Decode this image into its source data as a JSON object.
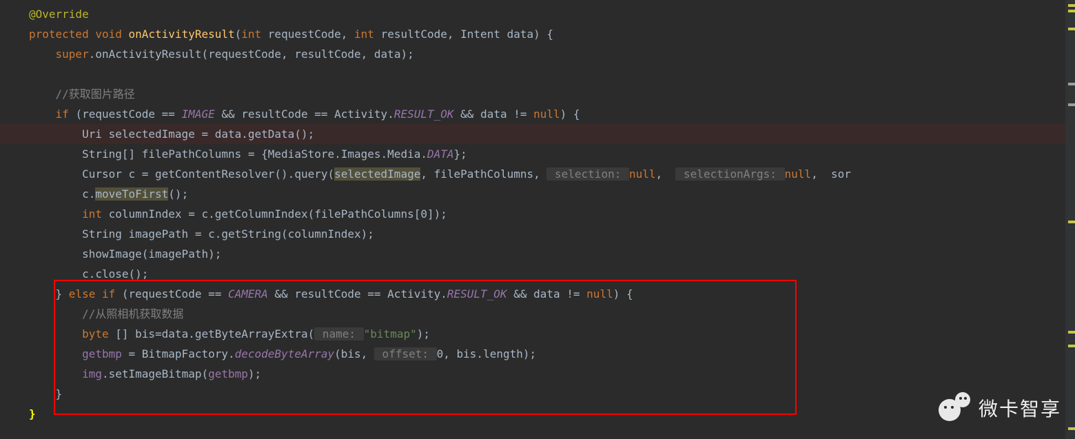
{
  "code": {
    "l1": "@Override",
    "l2_protected": "protected ",
    "l2_void": "void ",
    "l2_fn": "onActivityResult",
    "l2_p1": "(",
    "l2_int1": "int ",
    "l2_req": "requestCode, ",
    "l2_int2": "int ",
    "l2_res": "resultCode, Intent data) {",
    "l3_super": "super",
    "l3_rest": ".onActivityResult(requestCode, resultCode, data);",
    "l5_com": "//获取图片路径",
    "l6_if": "if ",
    "l6_a": "(requestCode == ",
    "l6_img": "IMAGE",
    "l6_b": " && resultCode == Activity.",
    "l6_rok": "RESULT_OK",
    "l6_c": " && data != ",
    "l6_null": "null",
    "l6_d": ") {",
    "l7_a": "Uri selectedImage = data.getData();",
    "l8_a": "String[] filePathColumns = {MediaStore.Images.Media.",
    "l8_data": "DATA",
    "l8_b": "};",
    "l9_a": "Cursor c = getContentResolver().query(",
    "l9_sel": "selectedImage",
    "l9_b": ", filePathColumns, ",
    "l9_h1": " selection: ",
    "l9_n1": "null",
    "l9_c": ",  ",
    "l9_h2": " selectionArgs: ",
    "l9_n2": "null",
    "l9_d": ",  sor",
    "l10_a": "c.",
    "l10_mtf": "moveToFirst",
    "l10_b": "();",
    "l11_int": "int ",
    "l11_a": "columnIndex = c.getColumnIndex(filePathColumns[",
    "l11_0": "0",
    "l11_b": "]);",
    "l12_a": "String imagePath = c.getString(columnIndex);",
    "l13_a": "showImage(imagePath);",
    "l14_a": "c.close();",
    "l15_a": "} ",
    "l15_else": "else if ",
    "l15_b": "(requestCode == ",
    "l15_cam": "CAMERA",
    "l15_c": " && resultCode == Activity.",
    "l15_rok": "RESULT_OK",
    "l15_d": " && data != ",
    "l15_null": "null",
    "l15_e": ") {",
    "l16_com": "//从照相机获取数据",
    "l17_byte": "byte ",
    "l17_a": "[] bis=data.getByteArrayExtra(",
    "l17_h": " name: ",
    "l17_str": "\"bitmap\"",
    "l17_b": ");",
    "l18_get": "getbmp",
    "l18_a": " = BitmapFactory.",
    "l18_dec": "decodeByteArray",
    "l18_b": "(bis, ",
    "l18_h": " offset: ",
    "l18_0": "0",
    "l18_c": ", bis.length);",
    "l19_img": "img",
    "l19_a": ".setImageBitmap(",
    "l19_get": "getbmp",
    "l19_b": ");",
    "l20_a": "}",
    "l21_a": "}"
  },
  "watermark": "微卡智享"
}
